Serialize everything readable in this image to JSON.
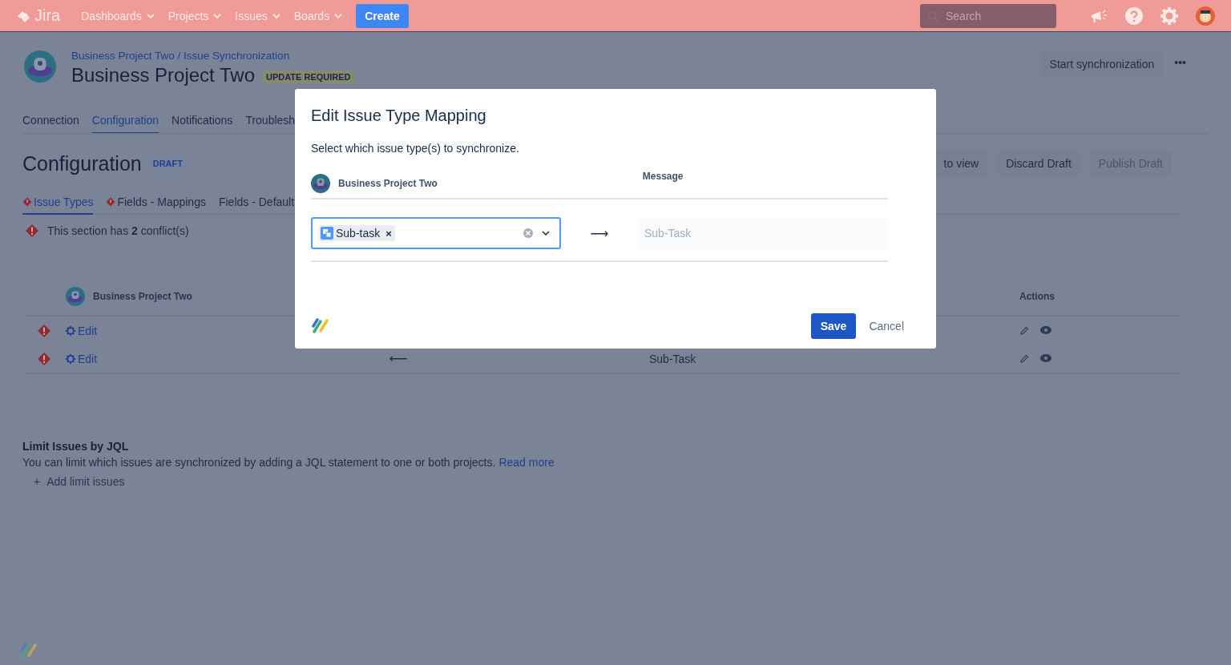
{
  "topbar": {
    "logo": "Jira",
    "nav": [
      {
        "label": "Dashboards"
      },
      {
        "label": "Projects"
      },
      {
        "label": "Issues"
      },
      {
        "label": "Boards"
      }
    ],
    "create": "Create",
    "search": {
      "placeholder": "Search"
    }
  },
  "header": {
    "breadcrumb": "Business Project Two / Issue Synchronization",
    "title": "Business Project Two",
    "badge": "UPDATE REQUIRED",
    "action": "Start synchronization",
    "more": "•••"
  },
  "tabs": [
    {
      "label": "Connection",
      "selected": false
    },
    {
      "label": "Configuration",
      "selected": true
    },
    {
      "label": "Notifications",
      "selected": false
    },
    {
      "label": "Troublesh",
      "selected": false
    }
  ],
  "section": {
    "title": "Configuration",
    "badge": "DRAFT",
    "buttons": [
      {
        "label": "to view",
        "disabled": false
      },
      {
        "label": "Discard Draft",
        "disabled": false
      },
      {
        "label": "Publish Draft",
        "disabled": true
      }
    ]
  },
  "subtabs": [
    {
      "label": "Issue Types",
      "selected": true,
      "conflict": true
    },
    {
      "label": "Fields - Mappings",
      "selected": false,
      "conflict": true
    },
    {
      "label": "Fields - Default",
      "selected": false,
      "conflict": false
    }
  ],
  "conflict_notice": "This section has **2** conflict(s)",
  "table": {
    "columns": [
      "Business Project Two",
      "Actions"
    ],
    "rows": [
      {
        "conflict": true,
        "edit": "Edit"
      },
      {
        "conflict": true,
        "edit": "Edit",
        "arrow": "⟵",
        "target": "Sub-Task"
      }
    ]
  },
  "jql": {
    "title": "Limit Issues by JQL",
    "text": "You can limit which issues are synchronized by adding a JQL statement to one or both projects.",
    "link": "Read more",
    "add_icon": "+",
    "add": "Add limit issues"
  },
  "modal": {
    "title": "Edit Issue Type Mapping",
    "description": "Select which issue type(s) to synchronize.",
    "left_header": "Business Project Two",
    "right_header": "Message",
    "tags": [
      {
        "label": "Sub-task",
        "remove": "×"
      }
    ],
    "arrow": "⟶",
    "target": {
      "value": "Sub-Task",
      "disabled": true
    },
    "buttons": [
      {
        "label": "Save",
        "primary": true
      },
      {
        "label": "Cancel",
        "primary": false
      }
    ]
  }
}
